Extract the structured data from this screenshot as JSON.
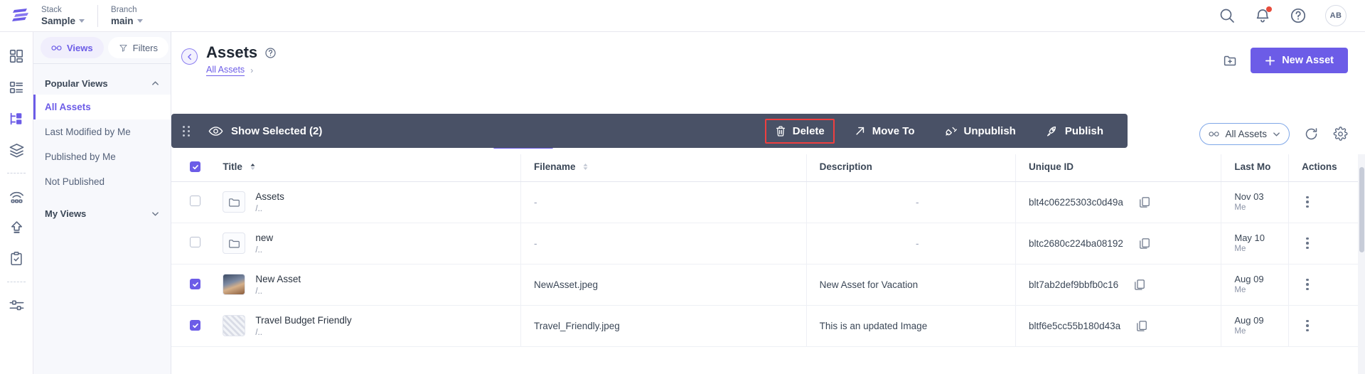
{
  "colors": {
    "accent": "#6c5ce7",
    "dark_bar": "#495166",
    "danger": "#ef3f3f",
    "panel_bg": "#f7f8fc"
  },
  "topbar": {
    "logo": "contentstack-logo",
    "context": [
      {
        "label": "Stack",
        "value": "Sample"
      },
      {
        "label": "Branch",
        "value": "main"
      }
    ],
    "icons": [
      {
        "name": "search-icon"
      },
      {
        "name": "notification-bell-icon",
        "has_badge": true
      },
      {
        "name": "help-circle-icon"
      }
    ],
    "avatar_initials": "AB"
  },
  "rail": {
    "items": [
      {
        "name": "dashboard-icon"
      },
      {
        "name": "content-types-icon"
      },
      {
        "name": "assets-icon",
        "active": true
      },
      {
        "name": "stack-layers-icon"
      },
      {
        "name": "live-preview-icon"
      },
      {
        "name": "publish-queue-icon"
      },
      {
        "name": "audit-log-icon"
      },
      {
        "name": "settings-sliders-icon"
      }
    ]
  },
  "views_panel": {
    "toolbar": {
      "views_label": "Views",
      "filters_label": "Filters"
    },
    "groups": [
      {
        "title": "Popular Views",
        "expanded": true,
        "items": [
          {
            "label": "All Assets",
            "selected": true
          },
          {
            "label": "Last Modified by Me",
            "selected": false
          },
          {
            "label": "Published by Me",
            "selected": false
          },
          {
            "label": "Not Published",
            "selected": false
          }
        ]
      },
      {
        "title": "My Views",
        "expanded": false,
        "items": []
      }
    ]
  },
  "page": {
    "title": "Assets",
    "help_icon": "help-circle-icon",
    "back_icon": "chevron-left-icon",
    "breadcrumb": {
      "link": "All Assets",
      "separator": "›"
    },
    "new_folder_icon": "new-folder-icon",
    "new_asset_label": "New Asset"
  },
  "action_bar": {
    "drag_handle": "drag-handle-icon",
    "show_selected_label": "Show Selected (2)",
    "show_selected_icon": "eye-icon",
    "actions": [
      {
        "label": "Delete",
        "icon": "trash-icon",
        "highlighted": true
      },
      {
        "label": "Move To",
        "icon": "arrow-up-right-icon",
        "highlighted": false
      },
      {
        "label": "Unpublish",
        "icon": "unplug-icon",
        "highlighted": false
      },
      {
        "label": "Publish",
        "icon": "rocket-icon",
        "highlighted": false
      }
    ]
  },
  "filter_row": {
    "view_select": {
      "label": "All Assets",
      "icon": "views-icon",
      "chevron": "chevron-down-icon"
    },
    "refresh_icon": "refresh-icon",
    "settings_icon": "gear-icon"
  },
  "table": {
    "select_all_checked": true,
    "columns": [
      {
        "key": "title",
        "label": "Title",
        "sort": "asc"
      },
      {
        "key": "filename",
        "label": "Filename",
        "sort": "none"
      },
      {
        "key": "description",
        "label": "Description",
        "sort": "none"
      },
      {
        "key": "unique_id",
        "label": "Unique ID",
        "sort": "none"
      },
      {
        "key": "last_modified",
        "label": "Last Mo",
        "sort": "none"
      },
      {
        "key": "actions",
        "label": "Actions",
        "sort": "none"
      }
    ],
    "rows": [
      {
        "selected": false,
        "thumb": "folder-icon",
        "title": "Assets",
        "path": "/..",
        "filename": "-",
        "description": "-",
        "unique_id": "blt4c06225303c0d49a",
        "copy_icon": "copy-icon",
        "modified_date": "Nov 03",
        "modified_by": "Me"
      },
      {
        "selected": false,
        "thumb": "folder-icon",
        "title": "new",
        "path": "/..",
        "filename": "-",
        "description": "-",
        "unique_id": "bltc2680c224ba08192",
        "copy_icon": "copy-icon",
        "modified_date": "May 10",
        "modified_by": "Me"
      },
      {
        "selected": true,
        "thumb": "image-thumbnail",
        "title": "New Asset",
        "path": "/..",
        "filename": "NewAsset.jpeg",
        "description": "New Asset for Vacation",
        "unique_id": "blt7ab2def9bbfb0c16",
        "copy_icon": "copy-icon",
        "modified_date": "Aug 09",
        "modified_by": "Me"
      },
      {
        "selected": true,
        "thumb": "image-thumbnail",
        "title": "Travel Budget Friendly",
        "path": "/..",
        "filename": "Travel_Friendly.jpeg",
        "description": "This is an updated Image",
        "unique_id": "bltf6e5cc55b180d43a",
        "copy_icon": "copy-icon",
        "modified_date": "Aug 09",
        "modified_by": "Me"
      }
    ]
  }
}
